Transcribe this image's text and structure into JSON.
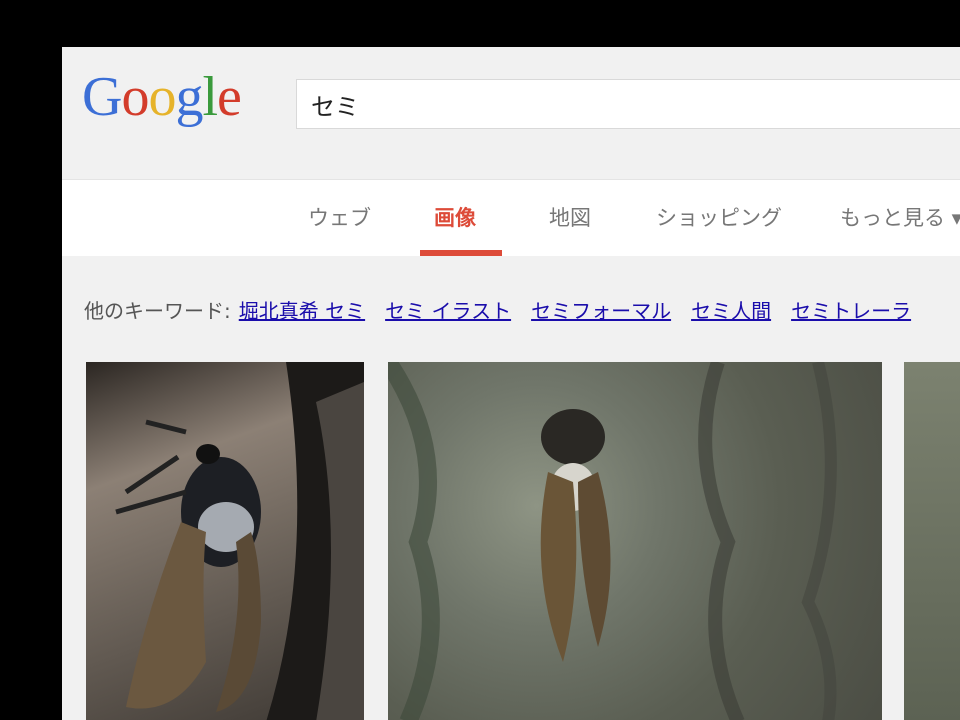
{
  "logo": {
    "letters": [
      {
        "ch": "G",
        "color": "#3c6fd6"
      },
      {
        "ch": "o",
        "color": "#d33c2b"
      },
      {
        "ch": "o",
        "color": "#e6b32a"
      },
      {
        "ch": "g",
        "color": "#3c6fd6"
      },
      {
        "ch": "l",
        "color": "#3a9a3c"
      },
      {
        "ch": "e",
        "color": "#d33c2b"
      }
    ]
  },
  "search": {
    "value": "セミ"
  },
  "tabs": [
    {
      "label": "ウェブ"
    },
    {
      "label": "画像"
    },
    {
      "label": "地図"
    },
    {
      "label": "ショッピング"
    },
    {
      "label": "もっと見る ▾"
    }
  ],
  "keywords": {
    "prefix": "他のキーワード:",
    "links": [
      "堀北真希 セミ",
      "セミ イラスト",
      "セミフォーマル",
      "セミ人間",
      "セミトレーラ"
    ]
  },
  "results": [
    {
      "alt": "cicada on tree trunk"
    },
    {
      "alt": "cicada on bark"
    },
    {
      "alt": "tree bark"
    }
  ]
}
